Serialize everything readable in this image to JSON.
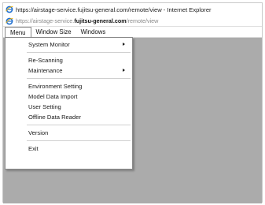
{
  "window": {
    "title": "https://airstage-service.fujitsu-general.com/remote/view - Internet Explorer"
  },
  "address": {
    "prefix": "https://airstage-service.",
    "domain": "fujitsu-general.com",
    "path": "/remote/view"
  },
  "menubar": {
    "items": [
      {
        "label": "Menu"
      },
      {
        "label": "Window Size"
      },
      {
        "label": "Windows"
      }
    ]
  },
  "dropdown": {
    "items": [
      {
        "label": "System Monitor",
        "submenu": true
      },
      {
        "label": "Re-Scanning"
      },
      {
        "label": "Maintenance",
        "submenu": true
      },
      {
        "label": "Environment Setting"
      },
      {
        "label": "Model Data Import"
      },
      {
        "label": "User Setting"
      },
      {
        "label": "Offline Data Reader"
      },
      {
        "label": "Version"
      },
      {
        "label": "Exit"
      }
    ]
  },
  "colors": {
    "content_background": "#ababab",
    "ie_blue": "#1f6fd0",
    "ie_yellow": "#f3b200"
  }
}
